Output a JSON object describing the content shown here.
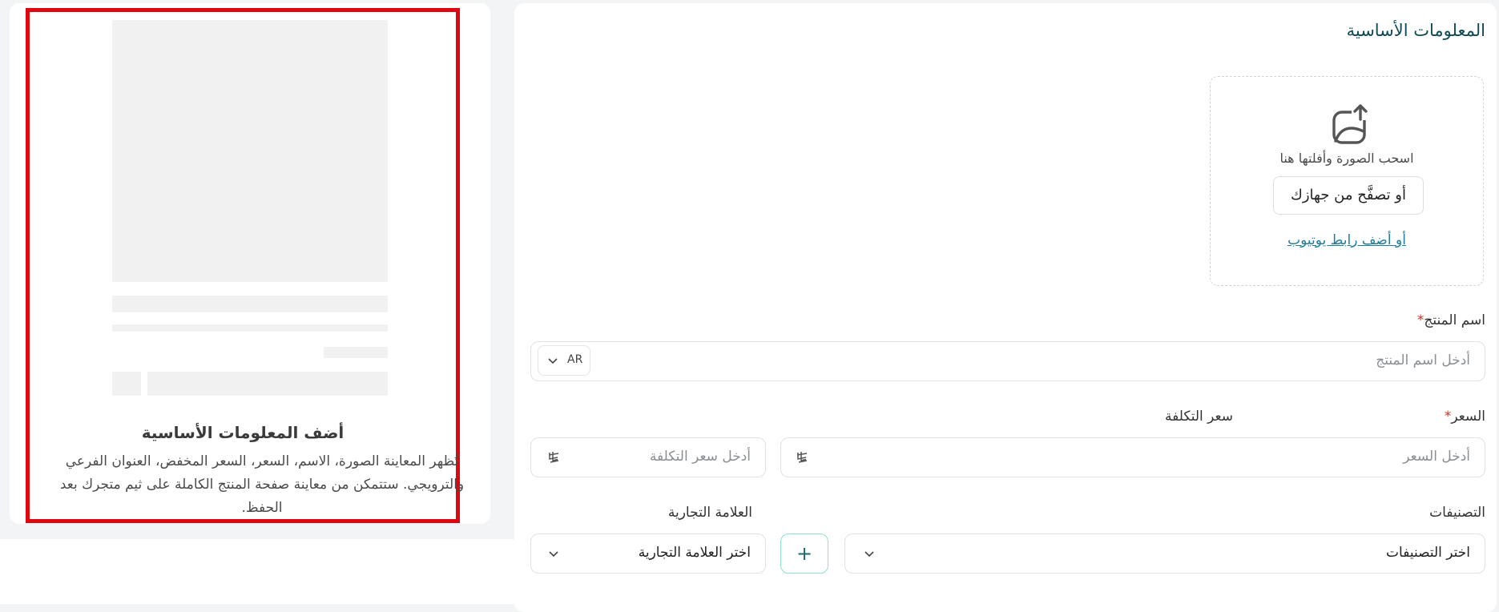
{
  "form": {
    "section_title": "المعلومات الأساسية",
    "upload": {
      "drag_text": "اسحب الصورة وأفلتها هنا",
      "browse_label": "أو تصفَّح من جهازك",
      "youtube_link": "أو أضف رابط يوتيوب",
      "icon": "image-upload-icon"
    },
    "product_name": {
      "label": "اسم المنتج",
      "required_mark": "*",
      "placeholder": "أدخل اسم المنتج",
      "lang": "AR"
    },
    "price": {
      "label": "السعر",
      "required_mark": "*",
      "placeholder": "أدخل السعر",
      "currency_icon": "riyal-icon"
    },
    "cost_price": {
      "label": "سعر التكلفة",
      "placeholder": "أدخل سعر التكلفة",
      "currency_icon": "riyal-icon"
    },
    "categories": {
      "label": "التصنيفات",
      "placeholder": "اختر التصنيفات",
      "add_label": "+"
    },
    "brand": {
      "label": "العلامة التجارية",
      "placeholder": "اختر العلامة التجارية"
    }
  },
  "preview": {
    "title": "أضف المعلومات الأساسية",
    "description": "تُظهر المعاينة الصورة، الاسم، السعر، السعر المخفض، العنوان الفرعي والترويجي. ستتمكن من معاينة صفحة المنتج الكاملة على ثيم متجرك بعد الحفظ."
  },
  "colors": {
    "accent": "#0e4a55",
    "link": "#1e7d9b",
    "required": "#d93025",
    "highlight_border": "#e0060f",
    "add_button_border": "#8fe0c6"
  }
}
